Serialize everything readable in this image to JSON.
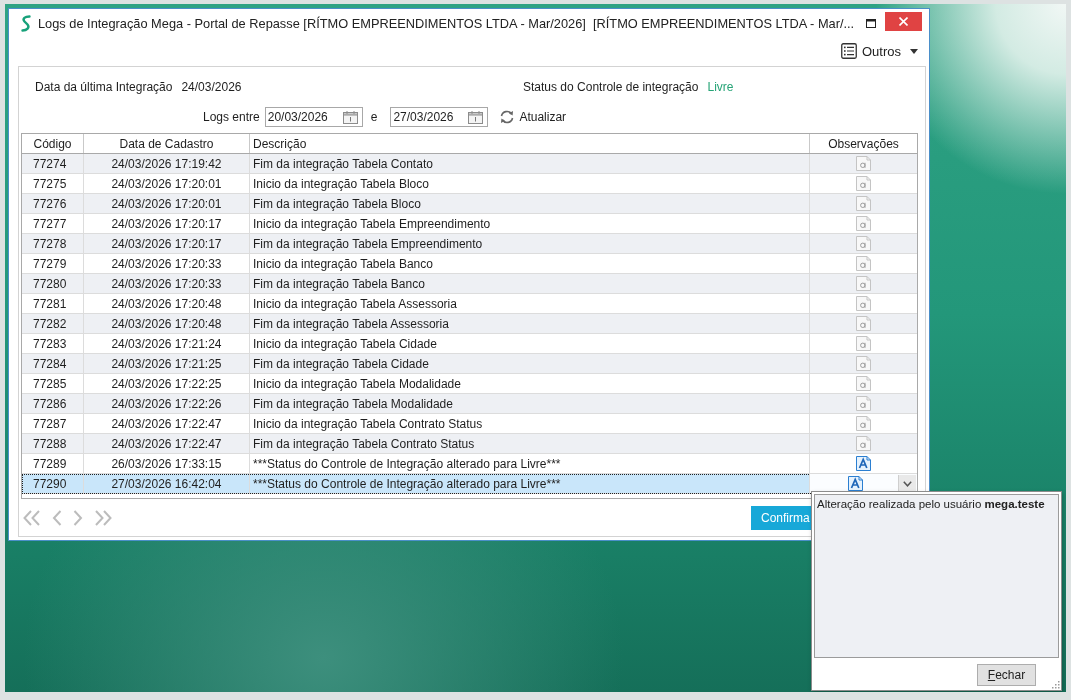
{
  "window": {
    "title": "Logs de Integração Mega - Portal de Repasse [RÍTMO EMPREENDIMENTOS LTDA - Mar/2026]  [RÍTMO EMPREENDIMENTOS LTDA - Mar/..."
  },
  "toolbar": {
    "menu_label": "Outros"
  },
  "info": {
    "last_integration_label": "Data da última Integração",
    "last_integration_value": "24/03/2026",
    "status_label": "Status do Controle de integração",
    "status_value": "Livre"
  },
  "filter": {
    "label": "Logs entre",
    "start": "20/03/2026",
    "separator": "e",
    "end": "27/03/2026",
    "refresh_label": "Atualizar"
  },
  "table": {
    "columns": [
      "Código",
      "Data de Cadastro",
      "Descrição",
      "Observações"
    ],
    "rows": [
      {
        "code": "77274",
        "date": "24/03/2026 17:19:42",
        "description": "Fim da integração Tabela Contato",
        "has_note": false,
        "expanded": false,
        "selected": false
      },
      {
        "code": "77275",
        "date": "24/03/2026 17:20:01",
        "description": "Inicio da integração Tabela Bloco",
        "has_note": false,
        "expanded": false,
        "selected": false
      },
      {
        "code": "77276",
        "date": "24/03/2026 17:20:01",
        "description": "Fim da integração Tabela Bloco",
        "has_note": false,
        "expanded": false,
        "selected": false
      },
      {
        "code": "77277",
        "date": "24/03/2026 17:20:17",
        "description": "Inicio da integração Tabela Empreendimento",
        "has_note": false,
        "expanded": false,
        "selected": false
      },
      {
        "code": "77278",
        "date": "24/03/2026 17:20:17",
        "description": "Fim da integração Tabela Empreendimento",
        "has_note": false,
        "expanded": false,
        "selected": false
      },
      {
        "code": "77279",
        "date": "24/03/2026 17:20:33",
        "description": "Inicio da integração Tabela Banco",
        "has_note": false,
        "expanded": false,
        "selected": false
      },
      {
        "code": "77280",
        "date": "24/03/2026 17:20:33",
        "description": "Fim da integração Tabela Banco",
        "has_note": false,
        "expanded": false,
        "selected": false
      },
      {
        "code": "77281",
        "date": "24/03/2026 17:20:48",
        "description": "Inicio da integração Tabela Assessoria",
        "has_note": false,
        "expanded": false,
        "selected": false
      },
      {
        "code": "77282",
        "date": "24/03/2026 17:20:48",
        "description": "Fim da integração Tabela Assessoria",
        "has_note": false,
        "expanded": false,
        "selected": false
      },
      {
        "code": "77283",
        "date": "24/03/2026 17:21:24",
        "description": "Inicio da integração Tabela Cidade",
        "has_note": false,
        "expanded": false,
        "selected": false
      },
      {
        "code": "77284",
        "date": "24/03/2026 17:21:25",
        "description": "Fim da integração Tabela Cidade",
        "has_note": false,
        "expanded": false,
        "selected": false
      },
      {
        "code": "77285",
        "date": "24/03/2026 17:22:25",
        "description": "Inicio da integração Tabela Modalidade",
        "has_note": false,
        "expanded": false,
        "selected": false
      },
      {
        "code": "77286",
        "date": "24/03/2026 17:22:26",
        "description": "Fim da integração Tabela Modalidade",
        "has_note": false,
        "expanded": false,
        "selected": false
      },
      {
        "code": "77287",
        "date": "24/03/2026 17:22:47",
        "description": "Inicio da integração Tabela Contrato Status",
        "has_note": false,
        "expanded": false,
        "selected": false
      },
      {
        "code": "77288",
        "date": "24/03/2026 17:22:47",
        "description": "Fim da integração Tabela Contrato Status",
        "has_note": false,
        "expanded": false,
        "selected": false
      },
      {
        "code": "77289",
        "date": "26/03/2026 17:33:15",
        "description": "***Status do Controle de Integração alterado para Livre***",
        "has_note": true,
        "expanded": false,
        "selected": false
      },
      {
        "code": "77290",
        "date": "27/03/2026 16:42:04",
        "description": "***Status do Controle de Integração alterado para Livre***",
        "has_note": true,
        "expanded": true,
        "selected": true
      }
    ]
  },
  "pager": {
    "disabled": true
  },
  "confirm_button": "Confirma",
  "note_popup": {
    "text": "Alteração realizada pelo usuário **mega.teste**",
    "close_button": "Fechar"
  }
}
